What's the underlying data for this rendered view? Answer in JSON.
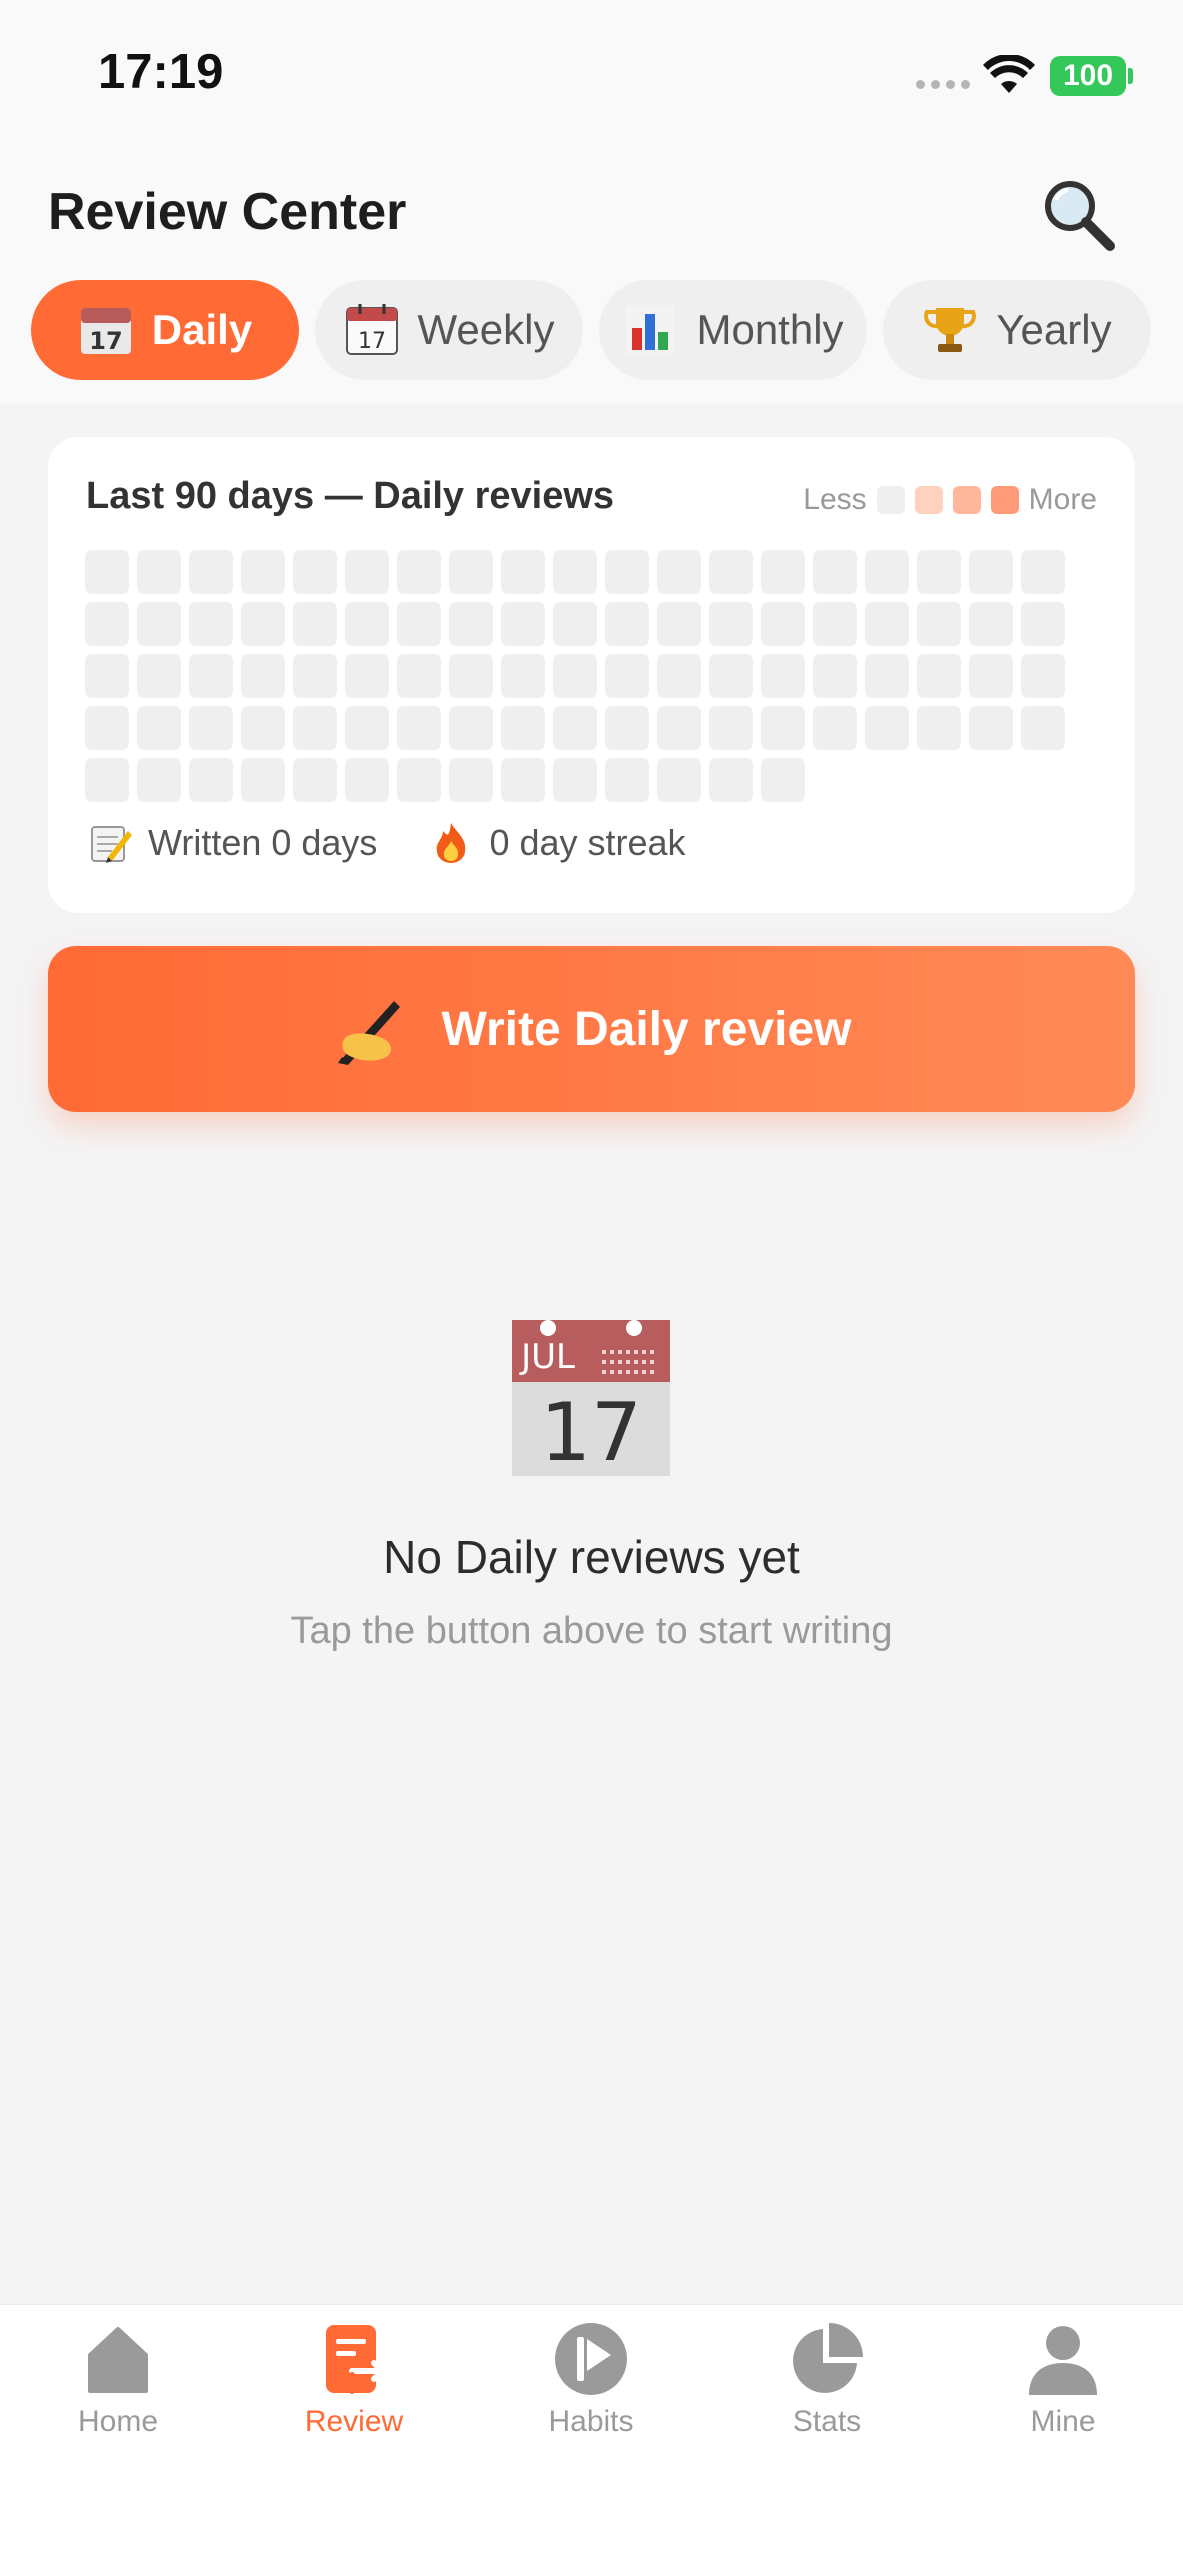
{
  "status_bar": {
    "time": "17:19",
    "battery": "100",
    "battery_color": "#34c759"
  },
  "header": {
    "title": "Review Center",
    "search_icon": "magnifier-icon"
  },
  "tabs": [
    {
      "label": "Daily",
      "icon": "daily-calendar-icon",
      "active": true
    },
    {
      "label": "Weekly",
      "icon": "weekly-calendar-icon",
      "active": false
    },
    {
      "label": "Monthly",
      "icon": "bar-chart-icon",
      "active": false
    },
    {
      "label": "Yearly",
      "icon": "trophy-icon",
      "active": false
    }
  ],
  "heatmap": {
    "title": "Last 90 days — Daily reviews",
    "legend_less": "Less",
    "legend_more": "More",
    "legend_colors": [
      "#efefef",
      "#ffd2c0",
      "#ffb79c",
      "#ff9a78"
    ],
    "days_shown": 90,
    "filled_days": 0,
    "written_text": "Written 0 days",
    "streak_text": "0 day streak"
  },
  "write_button": {
    "label": "Write Daily review",
    "icon": "writing-hand-icon"
  },
  "empty_state": {
    "icon": "calendar-jul-17-icon",
    "icon_month": "JUL",
    "icon_day": "17",
    "title": "No Daily reviews yet",
    "subtitle": "Tap the button above to start writing"
  },
  "bottom_nav": [
    {
      "label": "Home",
      "icon": "home-icon",
      "active": false
    },
    {
      "label": "Review",
      "icon": "review-icon",
      "active": true
    },
    {
      "label": "Habits",
      "icon": "habits-icon",
      "active": false
    },
    {
      "label": "Stats",
      "icon": "pie-chart-icon",
      "active": false
    },
    {
      "label": "Mine",
      "icon": "person-icon",
      "active": false
    }
  ],
  "colors": {
    "accent": "#ff6a35",
    "inactive": "#9a9a9a",
    "background": "#f4f4f5"
  }
}
